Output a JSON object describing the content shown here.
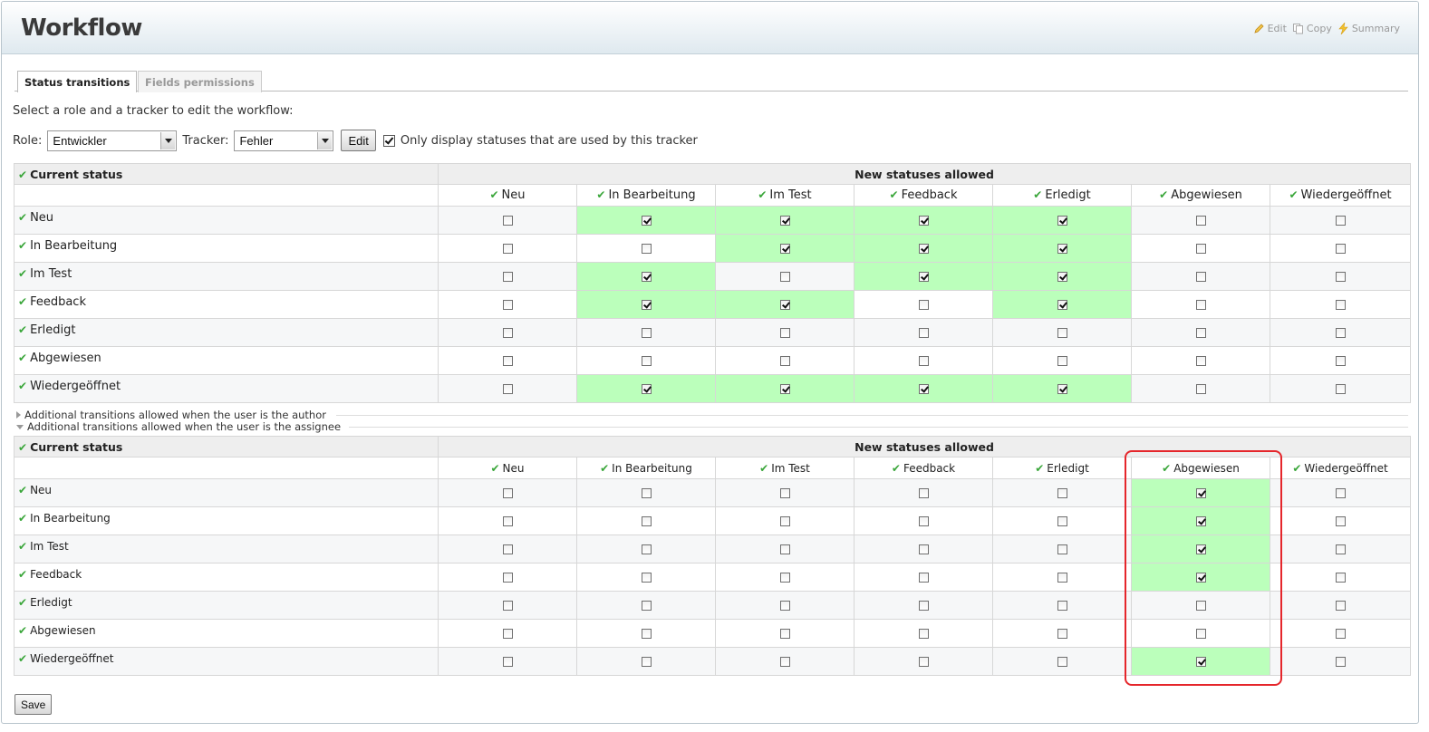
{
  "header": {
    "title": "Workflow",
    "actions": [
      {
        "label": "Edit",
        "icon": "pencil-icon"
      },
      {
        "label": "Copy",
        "icon": "copy-icon"
      },
      {
        "label": "Summary",
        "icon": "lightning-icon"
      }
    ]
  },
  "tabs": [
    {
      "label": "Status transitions",
      "selected": true
    },
    {
      "label": "Fields permissions",
      "selected": false
    }
  ],
  "intro": "Select a role and a tracker to edit the workflow:",
  "filters": {
    "role_label": "Role:",
    "role_value": "Entwickler",
    "tracker_label": "Tracker:",
    "tracker_value": "Fehler",
    "edit_button": "Edit",
    "only_used_checked": true,
    "only_used_label": "Only display statuses that are used by this tracker"
  },
  "statuses": [
    "Neu",
    "In Bearbeitung",
    "Im Test",
    "Feedback",
    "Erledigt",
    "Abgewiesen",
    "Wiedergeöffnet"
  ],
  "tables": {
    "current_status_label": "Current status",
    "new_statuses_label": "New statuses allowed"
  },
  "general_matrix": [
    [
      false,
      true,
      true,
      true,
      true,
      false,
      false
    ],
    [
      false,
      false,
      true,
      true,
      true,
      false,
      false
    ],
    [
      false,
      true,
      false,
      true,
      true,
      false,
      false
    ],
    [
      false,
      true,
      true,
      false,
      true,
      false,
      false
    ],
    [
      false,
      false,
      false,
      false,
      false,
      false,
      false
    ],
    [
      false,
      false,
      false,
      false,
      false,
      false,
      false
    ],
    [
      false,
      true,
      true,
      true,
      true,
      false,
      false
    ]
  ],
  "disclosures": {
    "author": "Additional transitions allowed when the user is the author",
    "assignee": "Additional transitions allowed when the user is the assignee"
  },
  "assignee_matrix": [
    [
      false,
      false,
      false,
      false,
      false,
      true,
      false
    ],
    [
      false,
      false,
      false,
      false,
      false,
      true,
      false
    ],
    [
      false,
      false,
      false,
      false,
      false,
      true,
      false
    ],
    [
      false,
      false,
      false,
      false,
      false,
      true,
      false
    ],
    [
      false,
      false,
      false,
      false,
      false,
      false,
      false
    ],
    [
      false,
      false,
      false,
      false,
      false,
      false,
      false
    ],
    [
      false,
      false,
      false,
      false,
      false,
      true,
      false
    ]
  ],
  "save_button": "Save",
  "colors": {
    "allowed_cell": "#bbffbb",
    "highlight_box": "#e5262b",
    "check_green": "#3aa63a"
  }
}
